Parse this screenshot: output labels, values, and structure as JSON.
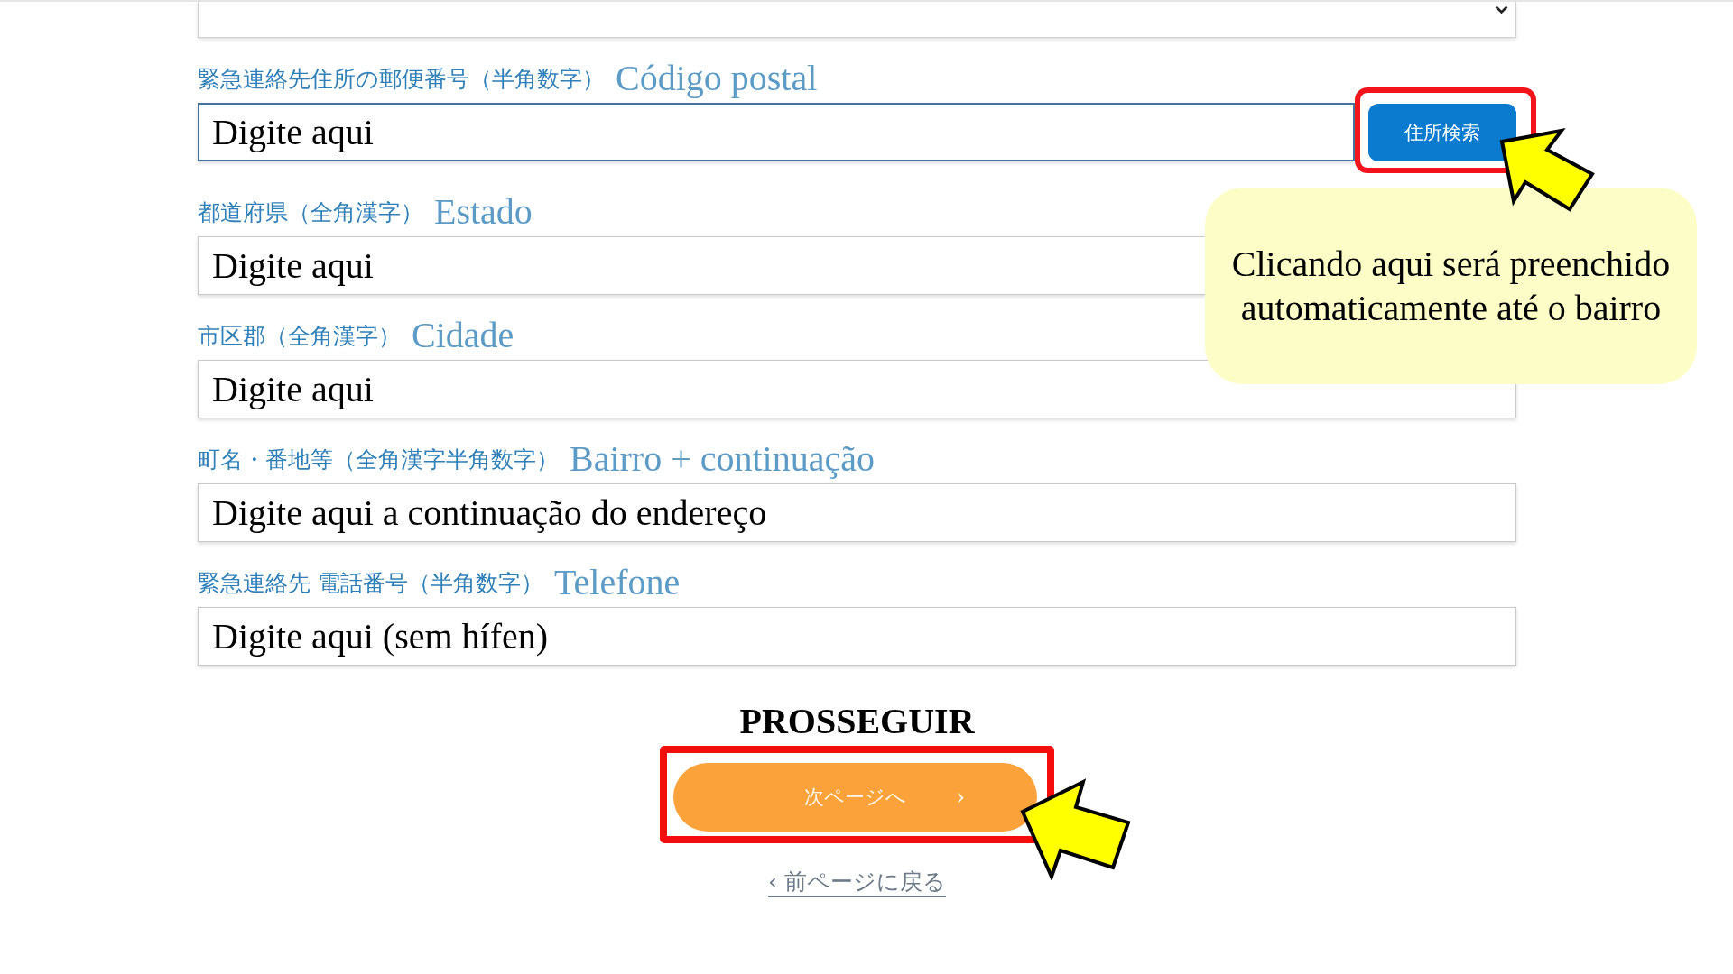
{
  "fields": [
    {
      "label": "緊急連絡先住所の郵便番号（半角数字）",
      "translation": "Código postal",
      "placeholder": "Digite aqui",
      "focused": true,
      "button": {
        "label": "住所検索",
        "highlighted": true
      }
    },
    {
      "label": "都道府県（全角漢字）",
      "translation": "Estado",
      "placeholder": "Digite aqui",
      "focused": false
    },
    {
      "label": "市区郡（全角漢字）",
      "translation": "Cidade",
      "placeholder": "Digite aqui",
      "focused": false
    },
    {
      "label": "町名・番地等（全角漢字半角数字）",
      "translation": "Bairro + continuação",
      "placeholder": "Digite aqui a continuação do endereço",
      "focused": false
    },
    {
      "label": "緊急連絡先 電話番号（半角数字）",
      "translation": "Telefone",
      "placeholder": "Digite aqui (sem hífen)",
      "focused": false
    }
  ],
  "callout": {
    "text": "Clicando aqui será preenchido automaticamente até o bairro"
  },
  "next": {
    "translation": "PROSSEGUIR",
    "button": {
      "label": "次ページへ",
      "chevron": "›",
      "highlighted": true
    }
  },
  "back_link": {
    "label": "‹ 前ページに戻る"
  }
}
